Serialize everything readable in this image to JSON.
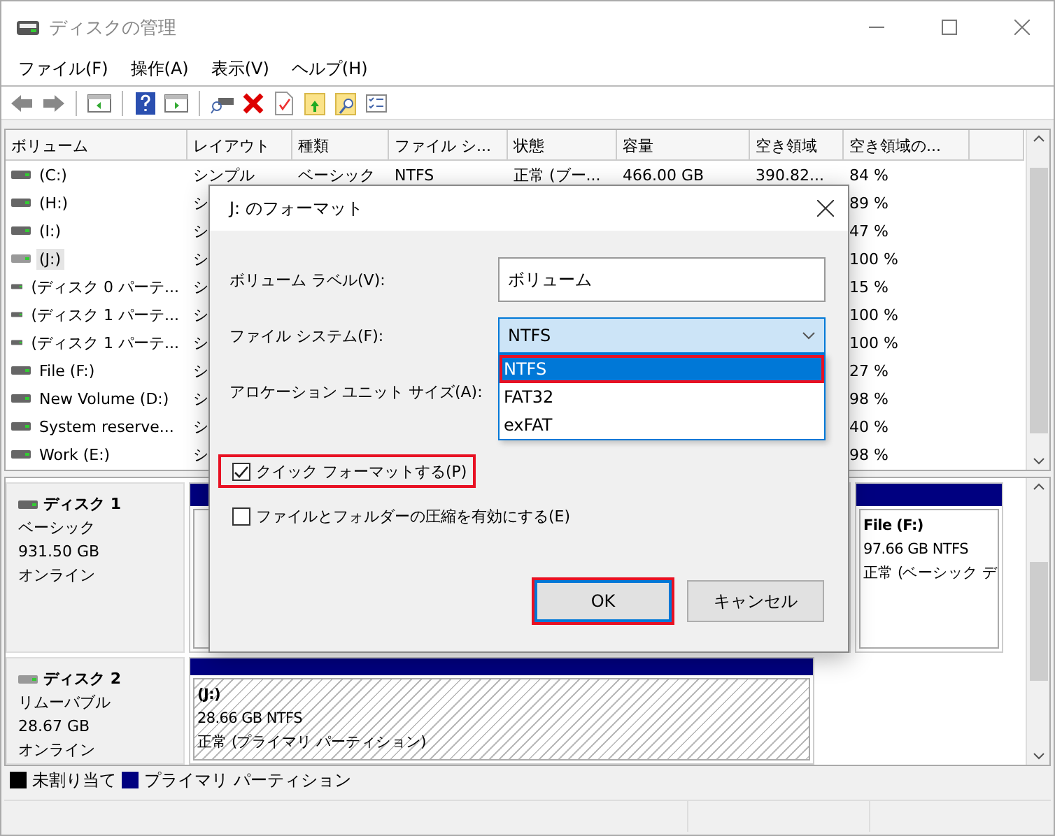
{
  "window": {
    "title": "ディスクの管理"
  },
  "menu": [
    "ファイル(F)",
    "操作(A)",
    "表示(V)",
    "ヘルプ(H)"
  ],
  "volume_table": {
    "columns": [
      "ボリューム",
      "レイアウト",
      "種類",
      "ファイル シ...",
      "状態",
      "容量",
      "空き領域",
      "空き領域の..."
    ],
    "rows": [
      {
        "volume": "(C:)",
        "layout": "シンプル",
        "type": "ベーシック",
        "file_system": "NTFS",
        "status": "正常 (ブー...",
        "capacity": "466.00 GB",
        "free_space": "390.82...",
        "free_percent": "84 %",
        "selected": false
      },
      {
        "volume": "(H:)",
        "layout": "シ",
        "free_percent": "89 %",
        "selected": false
      },
      {
        "volume": "(I:)",
        "layout": "シ",
        "free_percent": "47 %",
        "selected": false
      },
      {
        "volume": "(J:)",
        "layout": "シ",
        "free_percent": "100 %",
        "selected": true
      },
      {
        "volume": "(ディスク 0 パーテ...",
        "layout": "シ",
        "free_percent": "15 %",
        "selected": false
      },
      {
        "volume": "(ディスク 1 パーテ...",
        "layout": "シ",
        "free_percent": "100 %",
        "selected": false
      },
      {
        "volume": "(ディスク 1 パーテ...",
        "layout": "シ",
        "free_percent": "100 %",
        "selected": false
      },
      {
        "volume": "File (F:)",
        "layout": "シ",
        "free_percent": "27 %",
        "selected": false
      },
      {
        "volume": "New Volume (D:)",
        "layout": "シ",
        "free_percent": "98 %",
        "selected": false
      },
      {
        "volume": "System reserve...",
        "layout": "シ",
        "free_percent": "40 %",
        "selected": false
      },
      {
        "volume": "Work (E:)",
        "layout": "シ",
        "free_percent": "98 %",
        "selected": false
      }
    ]
  },
  "disks": [
    {
      "name": "ディスク 1",
      "type": "ベーシック",
      "size": "931.50 GB",
      "state": "オンライン",
      "partitions": [
        {
          "kind": "primary",
          "selected": false
        },
        {
          "kind": "primary",
          "selected": false,
          "name": "File  (F:)",
          "lines": [
            "97.66 GB NTFS",
            "正常 (ベーシック デ"
          ]
        }
      ]
    },
    {
      "name": "ディスク 2",
      "type": "リムーバブル",
      "size": "28.67 GB",
      "state": "オンライン",
      "partitions": [
        {
          "kind": "primary",
          "selected": true,
          "name": "(J:)",
          "lines": [
            "28.66 GB NTFS",
            "正常 (プライマリ パーティション)"
          ]
        }
      ]
    }
  ],
  "legend": [
    {
      "label": "未割り当て",
      "color": "#000000"
    },
    {
      "label": "プライマリ パーティション",
      "color": "#000080"
    }
  ],
  "dialog": {
    "title": "J: のフォーマット",
    "volume_label": {
      "label": "ボリューム ラベル(V):",
      "value": "ボリューム"
    },
    "file_system": {
      "label": "ファイル システム(F):",
      "value": "NTFS",
      "options": [
        {
          "label": "NTFS",
          "selected": true,
          "highlighted": true
        },
        {
          "label": "FAT32",
          "selected": false,
          "highlighted": false
        },
        {
          "label": "exFAT",
          "selected": false,
          "highlighted": false
        }
      ]
    },
    "allocation_label": "アロケーション ユニット サイズ(A):",
    "checkboxes": [
      {
        "label": "クイック フォーマットする(P)",
        "checked": true,
        "highlighted": true
      },
      {
        "label": "ファイルとフォルダーの圧縮を有効にする(E)",
        "checked": false,
        "highlighted": false
      }
    ],
    "buttons": [
      {
        "label": "OK",
        "default": true,
        "highlighted": true
      },
      {
        "label": "キャンセル",
        "default": false,
        "highlighted": false
      }
    ]
  }
}
